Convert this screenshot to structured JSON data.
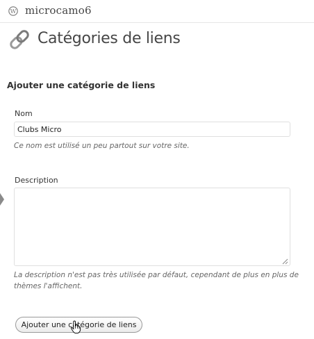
{
  "header": {
    "site_name": "microcamo6",
    "logo_icon": "wordpress-icon"
  },
  "page": {
    "title": "Catégories de liens",
    "title_icon": "links-icon"
  },
  "form": {
    "heading": "Ajouter une catégorie de liens",
    "name": {
      "label": "Nom",
      "value": "Clubs Micro",
      "help": "Ce nom est utilisé un peu partout sur votre site."
    },
    "description": {
      "label": "Description",
      "value": "",
      "help_line1": "La description n'est pas très utilisée par défaut, cependant de plus en plus de",
      "help_line2": "thèmes l'affichent."
    },
    "submit_label": "Ajouter une catégorie de liens"
  }
}
